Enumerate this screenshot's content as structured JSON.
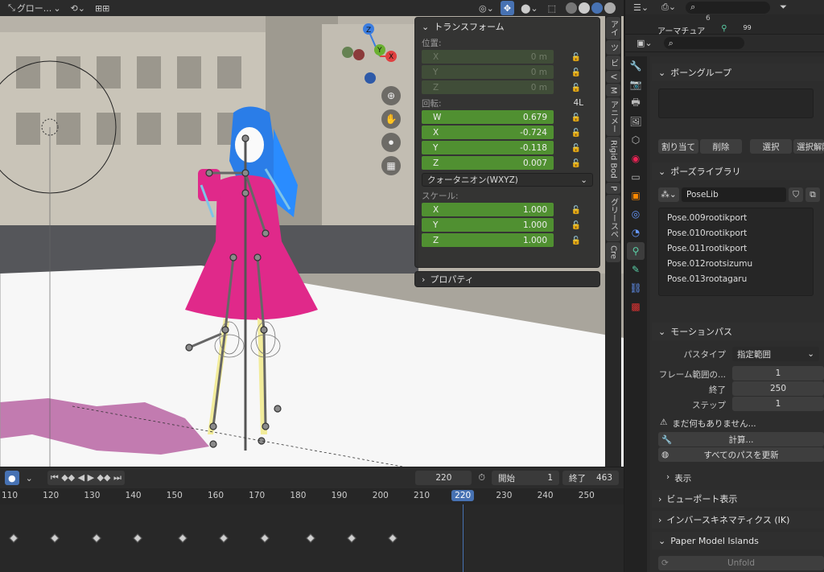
{
  "viewport_header": {
    "orientation_label": "グロー...",
    "snap_label": "⊞⊞",
    "items": [
      "ʟ↕",
      "⟲",
      "⊙",
      "↗"
    ]
  },
  "transform_panel": {
    "title": "トランスフォーム",
    "location_label": "位置:",
    "location": [
      {
        "axis": "X",
        "value": "0 m"
      },
      {
        "axis": "Y",
        "value": "0 m"
      },
      {
        "axis": "Z",
        "value": "0 m"
      }
    ],
    "rotation_label": "回転:",
    "rotation_extra": "4L",
    "rotation": [
      {
        "axis": "W",
        "value": "0.679"
      },
      {
        "axis": "X",
        "value": "-0.724"
      },
      {
        "axis": "Y",
        "value": "-0.118"
      },
      {
        "axis": "Z",
        "value": "0.007"
      }
    ],
    "rotation_mode": "クォータニオン(WXYZ)",
    "scale_label": "スケール:",
    "scale": [
      {
        "axis": "X",
        "value": "1.000"
      },
      {
        "axis": "Y",
        "value": "1.000"
      },
      {
        "axis": "Z",
        "value": "1.000"
      }
    ],
    "properties_title": "プロパティ"
  },
  "vertical_tabs": [
    "アイ",
    "ツ",
    "ビ",
    "V",
    "M",
    "アニメー",
    "Rigid Bod",
    "P",
    "グリースペ",
    "Cre"
  ],
  "timeline": {
    "current_frame": "220",
    "start_label": "開始",
    "start": "1",
    "end_label": "終了",
    "end": "463",
    "ruler": [
      "110",
      "120",
      "130",
      "140",
      "150",
      "160",
      "170",
      "180",
      "190",
      "200",
      "210",
      "220",
      "230",
      "240",
      "250"
    ],
    "keyframes": [
      111,
      121,
      131,
      141,
      152,
      162,
      172,
      183,
      193,
      203
    ]
  },
  "outliner": {
    "row1": "アーマチュア",
    "badge": "99",
    "row0_num": "6"
  },
  "properties": {
    "bone_groups_title": "ボーングループ",
    "assign": "割り当て",
    "remove": "削除",
    "select": "選択",
    "deselect": "選択解除",
    "pose_library_title": "ポーズライブラリ",
    "pose_lib_name": "PoseLib",
    "poses": [
      "Pose.009rootikport",
      "Pose.010rootikport",
      "Pose.011rootikport",
      "Pose.012rootsizumu",
      "Pose.013rootagaru"
    ],
    "motion_paths_title": "モーションパス",
    "path_type_label": "パスタイプ",
    "path_type_value": "指定範囲",
    "frame_range_label": "フレーム範囲の...",
    "frame_range_value": "1",
    "end_label": "終了",
    "end_value": "250",
    "step_label": "ステップ",
    "step_value": "1",
    "warning": "まだ何もありません...",
    "calculate": "計算...",
    "update_all": "すべてのパスを更新",
    "display": "表示",
    "viewport_display": "ビューポート表示",
    "ik": "インバースキネマティクス (IK)",
    "paper_model": "Paper Model Islands",
    "unfold": "Unfold"
  },
  "colors": {
    "green_field": "#4d8f2e",
    "accent_blue": "#4772b3",
    "dress": "#e0298a",
    "hair": "#2a8cff"
  }
}
